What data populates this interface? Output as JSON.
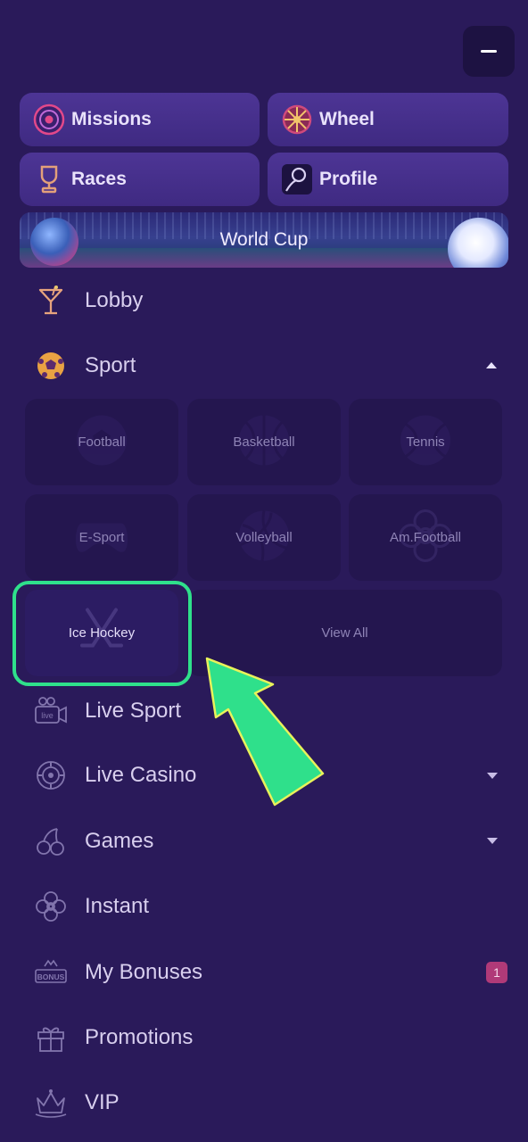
{
  "header": {
    "collapse_icon": "minus-icon"
  },
  "quick_links": [
    {
      "label": "Missions",
      "icon": "target-icon"
    },
    {
      "label": "Wheel",
      "icon": "wheel-icon"
    },
    {
      "label": "Races",
      "icon": "trophy-icon"
    },
    {
      "label": "Profile",
      "icon": "profile-icon"
    }
  ],
  "banner": {
    "label": "World Cup"
  },
  "menu": {
    "lobby": "Lobby",
    "sport": "Sport",
    "live_sport": "Live Sport",
    "live_casino": "Live Casino",
    "games": "Games",
    "instant": "Instant",
    "my_bonuses": "My Bonuses",
    "my_bonuses_badge": "1",
    "promotions": "Promotions",
    "vip": "VIP"
  },
  "sport_tiles": [
    {
      "label": "Football",
      "icon": "football-icon"
    },
    {
      "label": "Basketball",
      "icon": "basketball-icon"
    },
    {
      "label": "Tennis",
      "icon": "tennis-icon"
    },
    {
      "label": "E-Sport",
      "icon": "gamepad-icon"
    },
    {
      "label": "Volleyball",
      "icon": "volleyball-icon"
    },
    {
      "label": "Am.Football",
      "icon": "american-football-icon"
    },
    {
      "label": "Ice Hockey",
      "icon": "hockey-sticks-icon"
    },
    {
      "label": "View All"
    }
  ],
  "annotation": {
    "highlight_color": "#2fe08b",
    "arrow_color": "#2fe08b"
  }
}
